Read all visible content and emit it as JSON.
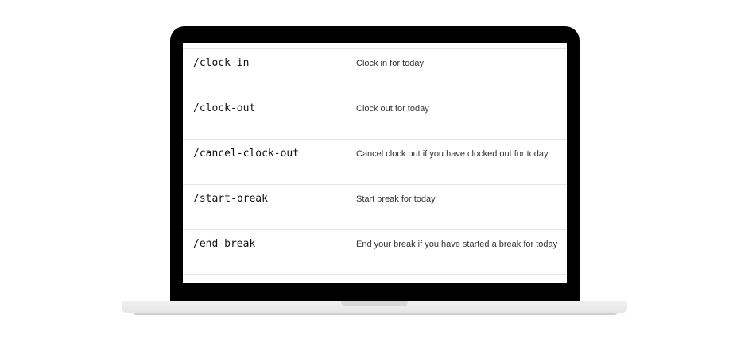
{
  "commands": [
    {
      "name": "/clock-in",
      "description": "Clock in for today"
    },
    {
      "name": "/clock-out",
      "description": "Clock out for today"
    },
    {
      "name": "/cancel-clock-out",
      "description": "Cancel clock out if you have clocked out for today"
    },
    {
      "name": "/start-break",
      "description": "Start break for today"
    },
    {
      "name": "/end-break",
      "description": "End your break if you have started a break for today"
    }
  ]
}
